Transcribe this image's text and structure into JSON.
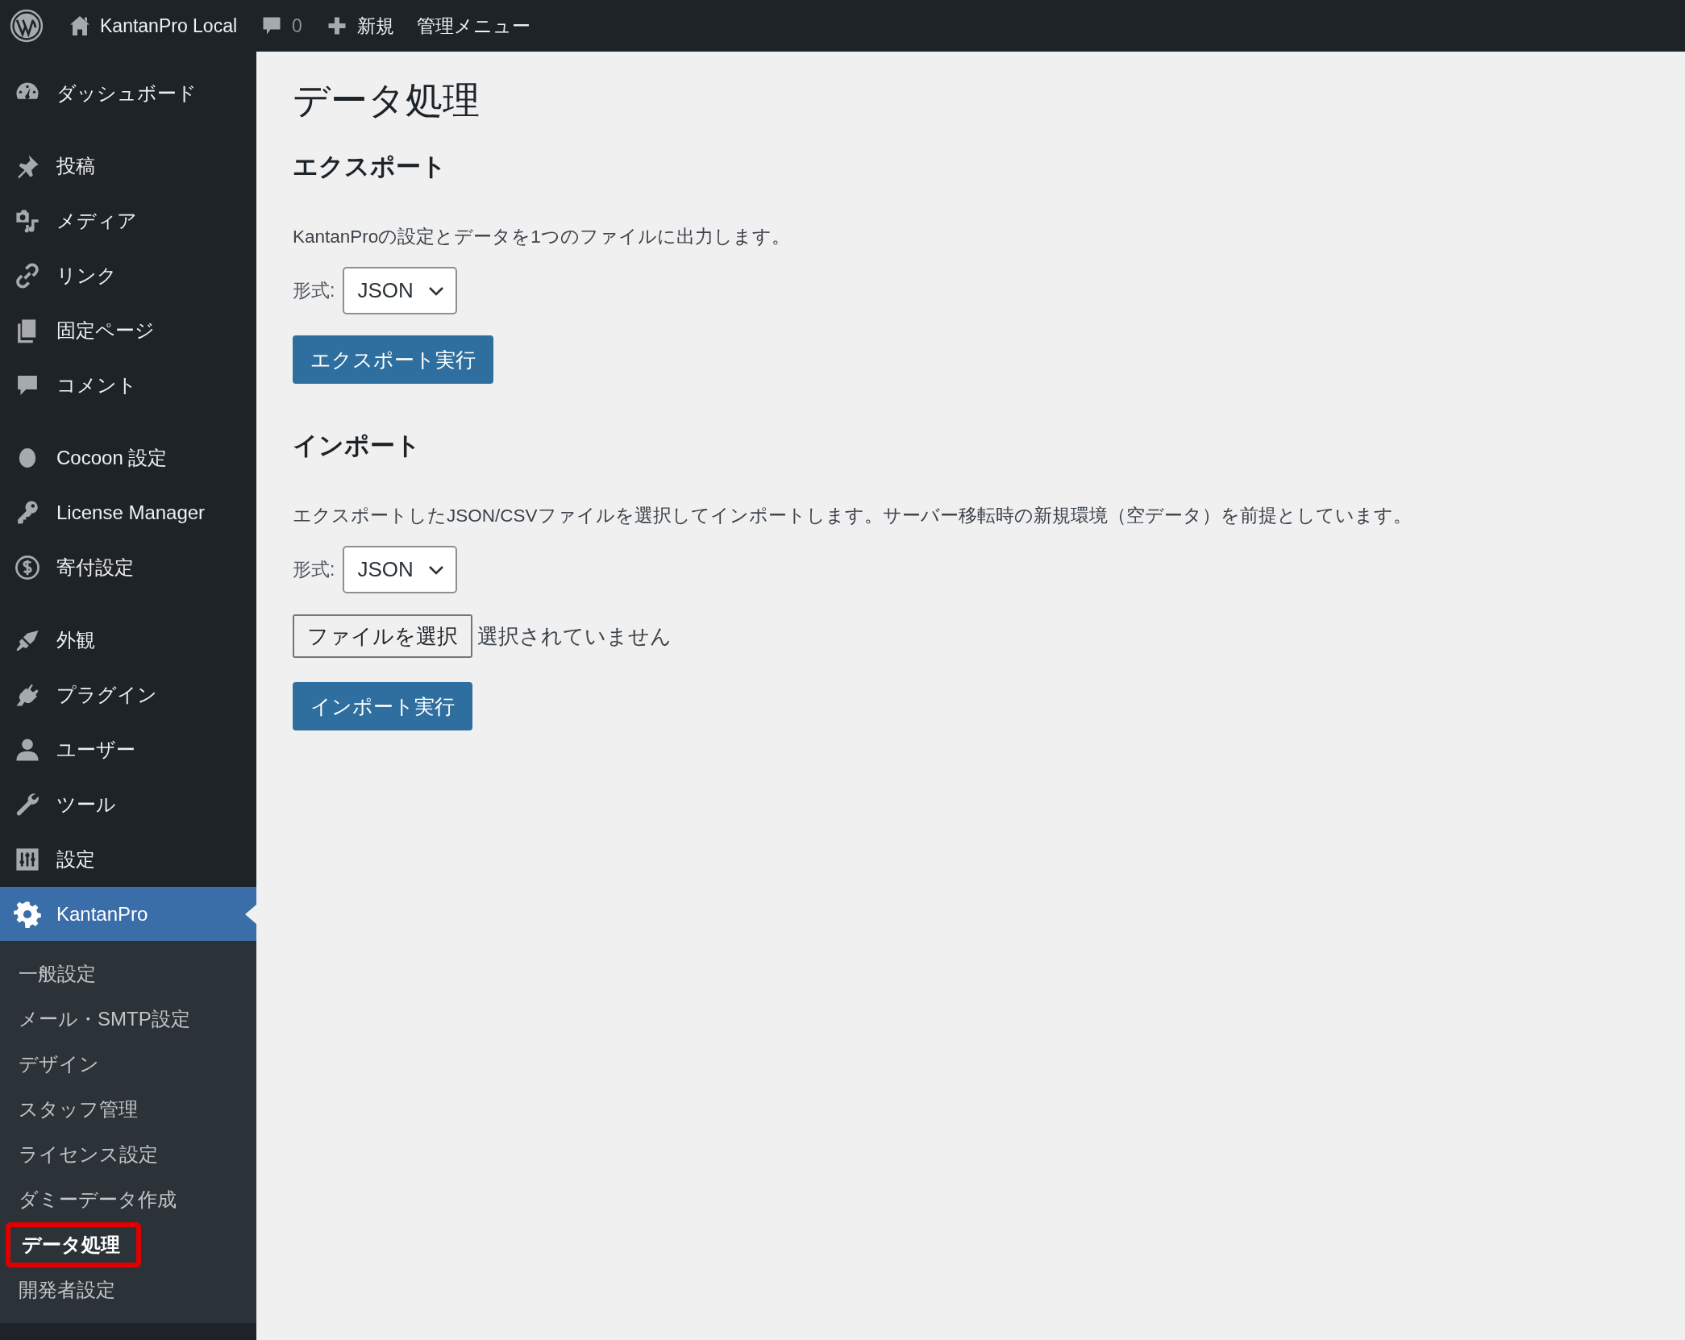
{
  "admin_bar": {
    "items": [
      {
        "kind": "logo"
      },
      {
        "kind": "site",
        "label": "KantanPro Local"
      },
      {
        "kind": "comments",
        "label": "0"
      },
      {
        "kind": "new",
        "label": "新規"
      },
      {
        "kind": "text",
        "label": "管理メニュー"
      }
    ]
  },
  "sidebar": {
    "groups": [
      [
        {
          "kind": "dashboard",
          "label": "ダッシュボード",
          "selected": false
        }
      ],
      [
        {
          "kind": "pin",
          "label": "投稿",
          "selected": false
        },
        {
          "kind": "media",
          "label": "メディア",
          "selected": false
        },
        {
          "kind": "link",
          "label": "リンク",
          "selected": false
        },
        {
          "kind": "pages",
          "label": "固定ページ",
          "selected": false
        },
        {
          "kind": "comment",
          "label": "コメント",
          "selected": false
        }
      ],
      [
        {
          "kind": "dot",
          "label": "Cocoon 設定",
          "selected": false
        },
        {
          "kind": "key",
          "label": "License Manager",
          "selected": false
        },
        {
          "kind": "dollar",
          "label": "寄付設定",
          "selected": false
        }
      ],
      [
        {
          "kind": "brush",
          "label": "外観",
          "selected": false
        },
        {
          "kind": "plug",
          "label": "プラグイン",
          "selected": false
        },
        {
          "kind": "user",
          "label": "ユーザー",
          "selected": false
        },
        {
          "kind": "wrench",
          "label": "ツール",
          "selected": false
        },
        {
          "kind": "sliders",
          "label": "設定",
          "selected": false
        },
        {
          "kind": "gear",
          "label": "KantanPro",
          "selected": true,
          "children": [
            {
              "label": "一般設定",
              "selected": false,
              "highlighted": false
            },
            {
              "label": "メール・SMTP設定",
              "selected": false,
              "highlighted": false
            },
            {
              "label": "デザイン",
              "selected": false,
              "highlighted": false
            },
            {
              "label": "スタッフ管理",
              "selected": false,
              "highlighted": false
            },
            {
              "label": "ライセンス設定",
              "selected": false,
              "highlighted": false
            },
            {
              "label": "ダミーデータ作成",
              "selected": false,
              "highlighted": false
            },
            {
              "label": "データ処理",
              "selected": true,
              "highlighted": true
            },
            {
              "label": "開発者設定",
              "selected": false,
              "highlighted": false
            }
          ]
        }
      ]
    ]
  },
  "page": {
    "title": "データ処理",
    "sections": [
      {
        "heading": "エクスポート",
        "description": "KantanProの設定とデータを1つのファイルに出力します。",
        "format_label": "形式:",
        "format_value": "JSON",
        "action": "エクスポート実行"
      },
      {
        "heading": "インポート",
        "description": "エクスポートしたJSON/CSVファイルを選択してインポートします。サーバー移転時の新規環境（空データ）を前提としています。",
        "format_label": "形式:",
        "format_value": "JSON",
        "file_button": "ファイルを選択",
        "file_status": "選択されていません",
        "action": "インポート実行"
      }
    ]
  }
}
